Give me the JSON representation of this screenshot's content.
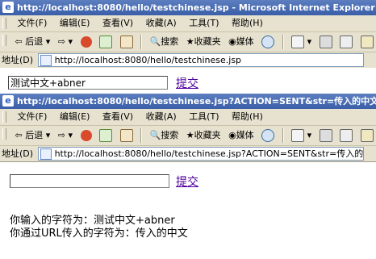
{
  "window1": {
    "title": "http://localhost:8080/hello/testchinese.jsp - Microsoft Internet Explorer",
    "address": "http://localhost:8080/hello/testchinese.jsp"
  },
  "window2": {
    "title": "http://localhost:8080/hello/testchinese.jsp?ACTION=SENT&str=传入的中文 - Micros",
    "address": "http://localhost:8080/hello/testchinese.jsp?ACTION=SENT&str=传入的中文"
  },
  "menu": [
    "文件(F)",
    "编辑(E)",
    "查看(V)",
    "收藏(A)",
    "工具(T)",
    "帮助(H)"
  ],
  "toolbar": {
    "back": "后退",
    "search": "搜索",
    "favorites": "收藏夹",
    "media": "媒体"
  },
  "address_label": "地址(D)",
  "form1": {
    "input_value": "测试中文+abner",
    "submit": "提交"
  },
  "form2": {
    "input_value": "",
    "submit": "提交"
  },
  "result": {
    "line1": "你输入的字符为：测试中文+abner",
    "line2": "你通过URL传入的字符为：传入的中文"
  }
}
